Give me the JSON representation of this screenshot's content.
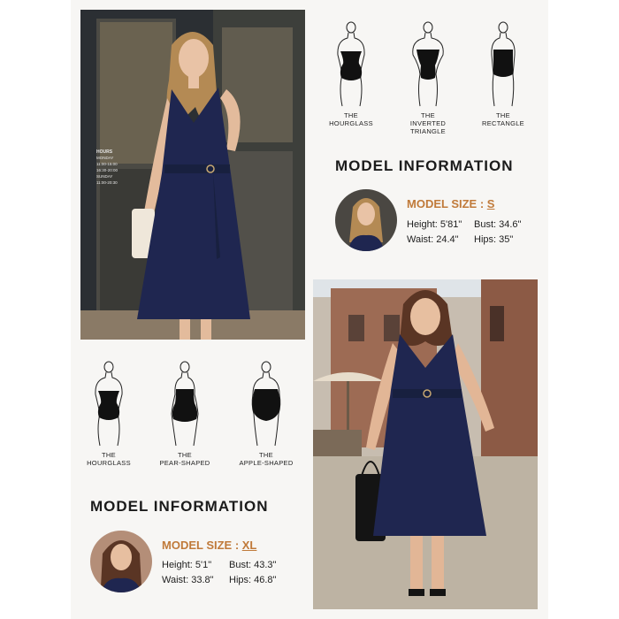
{
  "top_figures": [
    {
      "line1": "THE",
      "line2": "HOURGLASS"
    },
    {
      "line1": "THE",
      "line2": "INVERTED TRIANGLE"
    },
    {
      "line1": "THE",
      "line2": "RECTANGLE"
    }
  ],
  "bottom_figures": [
    {
      "line1": "THE",
      "line2": "HOURGLASS"
    },
    {
      "line1": "THE",
      "line2": "PEAR-SHAPED"
    },
    {
      "line1": "THE",
      "line2": "APPLE-SHAPED"
    }
  ],
  "model_top": {
    "heading": "MODEL INFORMATION",
    "size_label": "MODEL SIZE : ",
    "size_value": "S",
    "height": "Height: 5'81\"",
    "bust": "Bust: 34.6\"",
    "waist": "Waist: 24.4\"",
    "hips": "Hips: 35\""
  },
  "model_bottom": {
    "heading": "MODEL INFORMATION",
    "size_label": "MODEL SIZE : ",
    "size_value": "XL",
    "height": "Height: 5'1\"",
    "bust": "Bust: 43.3\"",
    "waist": "Waist: 33.8\"",
    "hips": "Hips: 46.8\""
  },
  "shop_sign": [
    "HOURS",
    "MONDAY",
    "11:00-15:00",
    "16:30-20:00",
    "SUNDAY",
    "11:00-20:30"
  ],
  "colors": {
    "dress": "#1f2650",
    "accent": "#c07a3a",
    "panel": "#f7f6f4"
  }
}
